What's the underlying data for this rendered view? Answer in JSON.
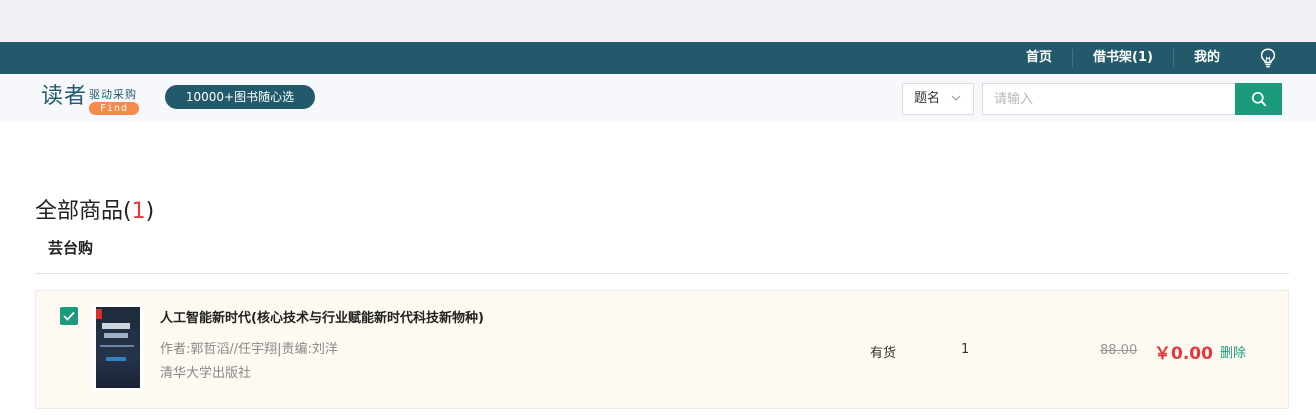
{
  "topnav": {
    "items": [
      {
        "label": "首页"
      },
      {
        "label": "借书架(1)"
      },
      {
        "label": "我的"
      }
    ],
    "bulb_icon": "lightbulb-icon"
  },
  "header": {
    "logo_main": "读者",
    "logo_sub": "驱动采购",
    "logo_badge": "Find",
    "promo": "10000+图书随心选",
    "search_type": "题名",
    "search_placeholder": "请输入",
    "search_icon": "search-icon"
  },
  "cart": {
    "title": "全部商品",
    "count_open": "(",
    "count": "1",
    "count_close": ")",
    "shop": "芸台购",
    "items": [
      {
        "checked": true,
        "title": "人工智能新时代(核心技术与行业赋能新时代科技新物种)",
        "author": "作者:郭哲滔//任宇翔|责编:刘洋",
        "publisher": "清华大学出版社",
        "stock": "有货",
        "quantity": "1",
        "original_price": "88.00",
        "price": "￥0.00",
        "delete_label": "删除"
      }
    ]
  },
  "colors": {
    "brand": "#235a6b",
    "accent": "#1a9c7c",
    "price": "#e4393c",
    "badge": "#f58a4b"
  }
}
